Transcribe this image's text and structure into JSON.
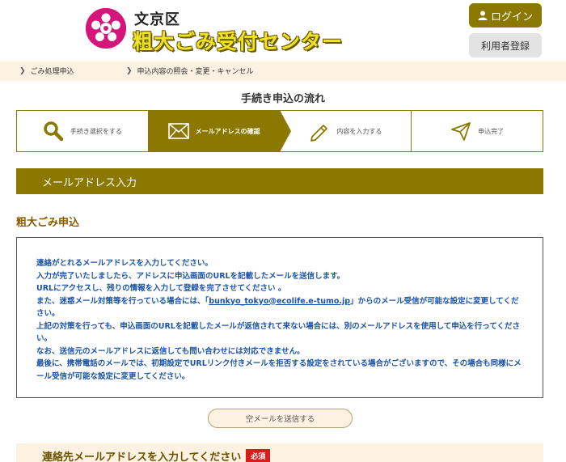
{
  "header": {
    "ward_name": "文京区",
    "site_title": "粗大ごみ受付センター",
    "login_label": "ログイン",
    "register_label": "利用者登録"
  },
  "nav": {
    "items": [
      {
        "label": "ごみ処理申込"
      },
      {
        "label": "申込内容の照会・変更・キャンセル"
      }
    ]
  },
  "flow": {
    "title": "手続き申込の流れ",
    "steps": [
      {
        "label": "手続き選択をする",
        "icon": "search-icon",
        "active": false
      },
      {
        "label": "メールアドレスの確認",
        "icon": "mail-icon",
        "active": true
      },
      {
        "label": "内容を入力する",
        "icon": "pencil-icon",
        "active": false
      },
      {
        "label": "申込完了",
        "icon": "send-icon",
        "active": false
      }
    ]
  },
  "section": {
    "title": "メールアドレス入力",
    "subtitle": "粗大ごみ申込"
  },
  "instructions": {
    "line1": "連絡がとれるメールアドレスを入力してください。",
    "line2": "入力が完了いたしましたら、アドレスに申込画面のURLを記載したメールを送信します。",
    "line3": "URLにアクセスし、残りの情報を入力して登録を完了させてください 。",
    "line4_before": "また、迷惑メール対策等を行っている場合には、「",
    "email": "bunkyo_tokyo@ecolife.e-tumo.jp",
    "line4_after": "」からのメール受信が可能な設定に変更してください。",
    "line5": "上記の対策を行っても、申込画面のURLを記載したメールが返信されて来ない場合には、別のメールアドレスを使用して申込を行ってください。",
    "line6": "なお、送信元のメールアドレスに返信しても問い合わせには対応できません。",
    "line7": "最後に、携帯電話のメールでは、初期設定でURLリンク付きメールを拒否する設定をされている場合がございますので、その場合も同様にメール受信が可能な設定に変更してください。"
  },
  "send_button_label": "空メールを送信する",
  "contact": {
    "label": "連絡先メールアドレスを入力してください",
    "required_badge": "必須"
  },
  "colors": {
    "accent": "#8a7800",
    "nav_bg": "#fdf1e2",
    "link": "#1b53a8",
    "required": "#d81b1b",
    "emblem": "#d6157a"
  }
}
